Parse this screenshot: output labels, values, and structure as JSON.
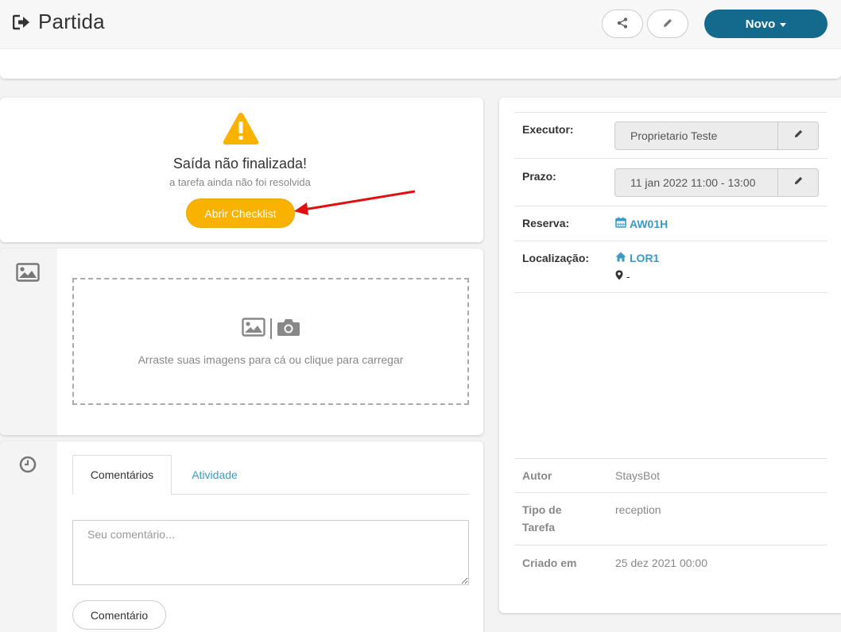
{
  "header": {
    "title": "Partida",
    "new_label": "Novo"
  },
  "alert": {
    "title": "Saída não finalizada!",
    "subtitle": "a tarefa ainda não foi resolvida",
    "button_label": "Abrir Checklist",
    "button_color": "#fab200",
    "arrow_color": "#e01010"
  },
  "images": {
    "dropzone_text": "Arraste suas imagens para cá ou clique para carregar"
  },
  "comments": {
    "tabs": [
      "Comentários",
      "Atividade"
    ],
    "active_tab": "Comentários",
    "placeholder": "Seu comentário...",
    "submit_label": "Comentário"
  },
  "details": {
    "executor_label": "Executor:",
    "executor_value": "Proprietario Teste",
    "deadline_label": "Prazo:",
    "deadline_value": "11 jan 2022 11:00 - 13:00",
    "reservation_label": "Reserva:",
    "reservation_value": "AW01H",
    "location_label": "Localização:",
    "location_value": "LOR1",
    "location_sub": "-",
    "author_label": "Autor",
    "author_value": "StaysBot",
    "type_label": "Tipo de Tarefa",
    "type_value": "reception",
    "created_label": "Criado em",
    "created_value": "25 dez 2021 00:00"
  },
  "colors": {
    "primary": "#146a8d",
    "link": "#3b9ac4",
    "warning": "#fab200"
  }
}
